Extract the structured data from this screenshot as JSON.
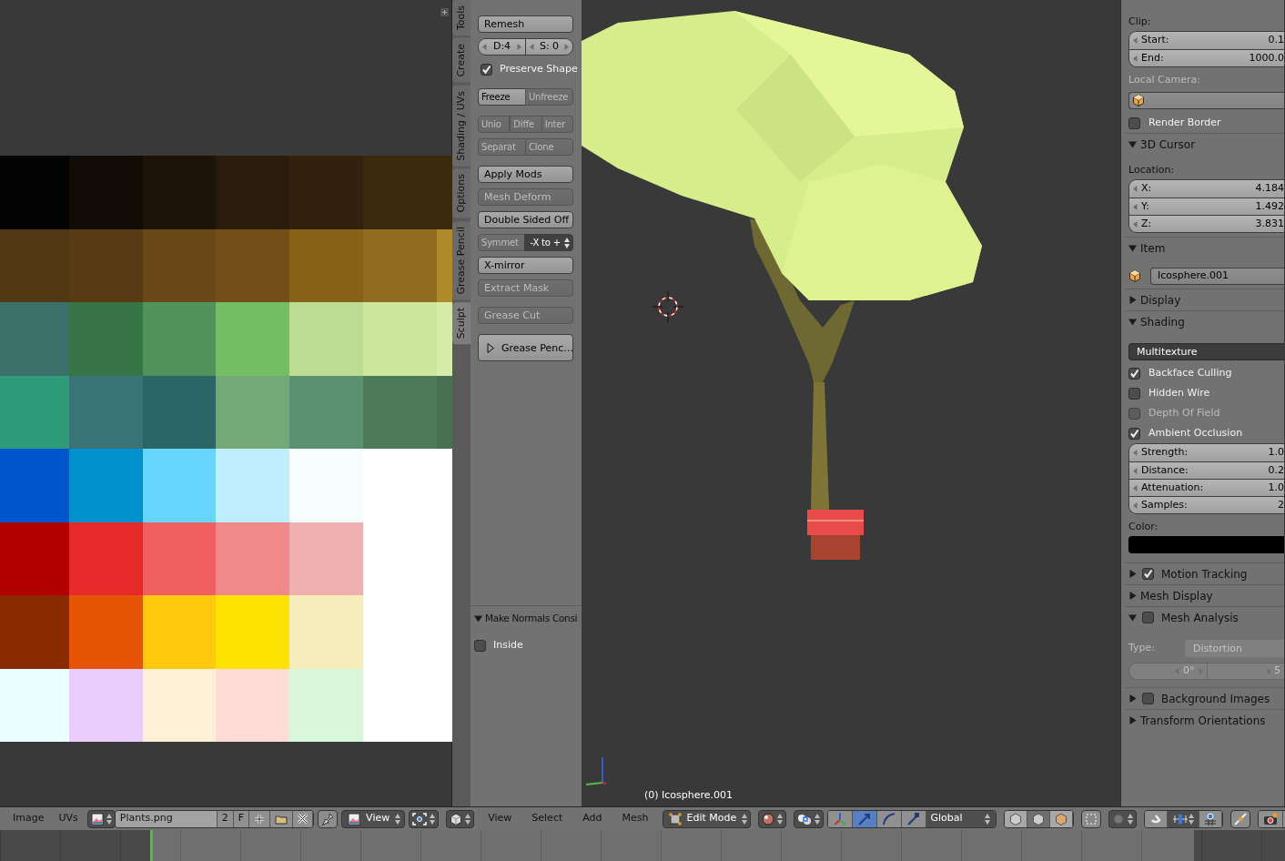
{
  "tool_tabs": [
    {
      "label": "Tools",
      "selected": false
    },
    {
      "label": "Create",
      "selected": false
    },
    {
      "label": "Shading / UVs",
      "selected": false
    },
    {
      "label": "Options",
      "selected": false
    },
    {
      "label": "Grease Pencil",
      "selected": false
    },
    {
      "label": "Sculpt",
      "selected": true
    }
  ],
  "tool_panel": {
    "groups": [
      [
        {
          "kind": "button",
          "label": "Remesh",
          "disabled": false
        },
        {
          "kind": "number_pair",
          "parts": [
            {
              "text": "D:4"
            },
            {
              "text": "S: 0"
            }
          ]
        },
        {
          "kind": "checkbox",
          "label": "Preserve Shape",
          "checked": true
        }
      ],
      [
        {
          "kind": "split",
          "parts": [
            {
              "kind": "button",
              "label": "Freeze",
              "disabled": false
            },
            {
              "kind": "button",
              "label": "Unfreeze",
              "disabled": true
            }
          ]
        }
      ],
      [
        {
          "kind": "split",
          "parts": [
            {
              "kind": "button",
              "label": "Unio",
              "disabled": true
            },
            {
              "kind": "button",
              "label": "Diffe",
              "disabled": true
            },
            {
              "kind": "button",
              "label": "Inter",
              "disabled": true
            }
          ]
        },
        {
          "kind": "split",
          "parts": [
            {
              "kind": "button",
              "label": "Separat",
              "disabled": true
            },
            {
              "kind": "button",
              "label": "Clone",
              "disabled": true
            }
          ]
        }
      ],
      [
        {
          "kind": "button",
          "label": "Apply Mods",
          "disabled": false
        },
        {
          "kind": "button",
          "label": "Mesh Deform",
          "disabled": true
        },
        {
          "kind": "button",
          "label": "Double Sided Off",
          "disabled": false
        },
        {
          "kind": "split",
          "parts": [
            {
              "kind": "button",
              "label": "Symmet",
              "disabled": true
            },
            {
              "kind": "dropdown",
              "label": "-X to +",
              "disabled": false
            }
          ]
        },
        {
          "kind": "button",
          "label": "X-mirror",
          "disabled": false
        },
        {
          "kind": "button",
          "label": "Extract Mask",
          "disabled": true
        }
      ],
      [
        {
          "kind": "button",
          "label": "Grease Cut",
          "disabled": true
        }
      ],
      [
        {
          "kind": "panel",
          "label": "Grease Penc…",
          "expanded": false
        }
      ]
    ]
  },
  "operator_panel": {
    "title": "Make Normals Consi",
    "expanded": true,
    "options": [
      {
        "label": "Inside",
        "checked": false
      }
    ]
  },
  "viewport": {
    "object_label": "(0) Icosphere.001"
  },
  "properties": [
    {
      "kind": "label",
      "text": "Clip:",
      "disabled": false
    },
    {
      "kind": "fields",
      "fields": [
        {
          "label": "Start:",
          "value": "0.1"
        },
        {
          "label": "End:",
          "value": "1000.0"
        }
      ]
    },
    {
      "kind": "label",
      "text": "Local Camera:",
      "disabled": true
    },
    {
      "kind": "object_field"
    },
    {
      "kind": "checkbox",
      "label": "Render Border",
      "checked": false,
      "disabled": false
    },
    {
      "kind": "section",
      "label": "3D Cursor",
      "expanded": true
    },
    {
      "kind": "label",
      "text": "Location:",
      "disabled": false
    },
    {
      "kind": "fields",
      "fields": [
        {
          "label": "X:",
          "value": "4.184"
        },
        {
          "label": "Y:",
          "value": "1.492"
        },
        {
          "label": "Z:",
          "value": "3.831"
        }
      ]
    },
    {
      "kind": "section",
      "label": "Item",
      "expanded": true
    },
    {
      "kind": "object_field",
      "value": "Icosphere.001"
    },
    {
      "kind": "section",
      "label": "Display",
      "expanded": false
    },
    {
      "kind": "section",
      "label": "Shading",
      "expanded": true
    },
    {
      "kind": "dropdown",
      "value": "Multitexture"
    },
    {
      "kind": "checkbox",
      "label": "Backface Culling",
      "checked": true,
      "disabled": false
    },
    {
      "kind": "checkbox",
      "label": "Hidden Wire",
      "checked": false,
      "disabled": false
    },
    {
      "kind": "checkbox",
      "label": "Depth Of Field",
      "checked": false,
      "disabled": true
    },
    {
      "kind": "checkbox",
      "label": "Ambient Occlusion",
      "checked": true,
      "disabled": false
    },
    {
      "kind": "fields",
      "fields": [
        {
          "label": "Strength:",
          "value": "1.0"
        },
        {
          "label": "Distance:",
          "value": "0.2"
        },
        {
          "label": "Attenuation:",
          "value": "1.0"
        },
        {
          "label": "Samples:",
          "value": "2"
        }
      ]
    },
    {
      "kind": "label",
      "text": "Color:",
      "disabled": false
    },
    {
      "kind": "color",
      "color": "#000000"
    },
    {
      "kind": "section",
      "label": "Motion Tracking",
      "expanded": false,
      "checked": true
    },
    {
      "kind": "section",
      "label": "Mesh Display",
      "expanded": false
    },
    {
      "kind": "section",
      "label": "Mesh Analysis",
      "expanded": true,
      "checked": false
    },
    {
      "kind": "type_row",
      "label": "Type:",
      "value": "Distortion",
      "disabled": true
    },
    {
      "kind": "range",
      "values": [
        "0°",
        "5"
      ],
      "disabled": true
    },
    {
      "kind": "section",
      "label": "Background Images",
      "expanded": false,
      "checked": false
    },
    {
      "kind": "section",
      "label": "Transform Orientations",
      "expanded": false
    }
  ],
  "image_header": {
    "menus": [
      "Image",
      "UVs"
    ],
    "image_name": "Plants.png",
    "users": "2",
    "fake_user": "F",
    "view_menu": "View"
  },
  "view3d_header": {
    "menus": [
      "View",
      "Select",
      "Add",
      "Mesh"
    ],
    "mode": "Edit Mode",
    "manipulators": [
      {
        "kind": "axes",
        "selected": false
      },
      {
        "kind": "translate",
        "selected": true
      },
      {
        "kind": "rotate",
        "selected": false
      },
      {
        "kind": "scale",
        "selected": false
      }
    ],
    "orientation": "Global"
  }
}
